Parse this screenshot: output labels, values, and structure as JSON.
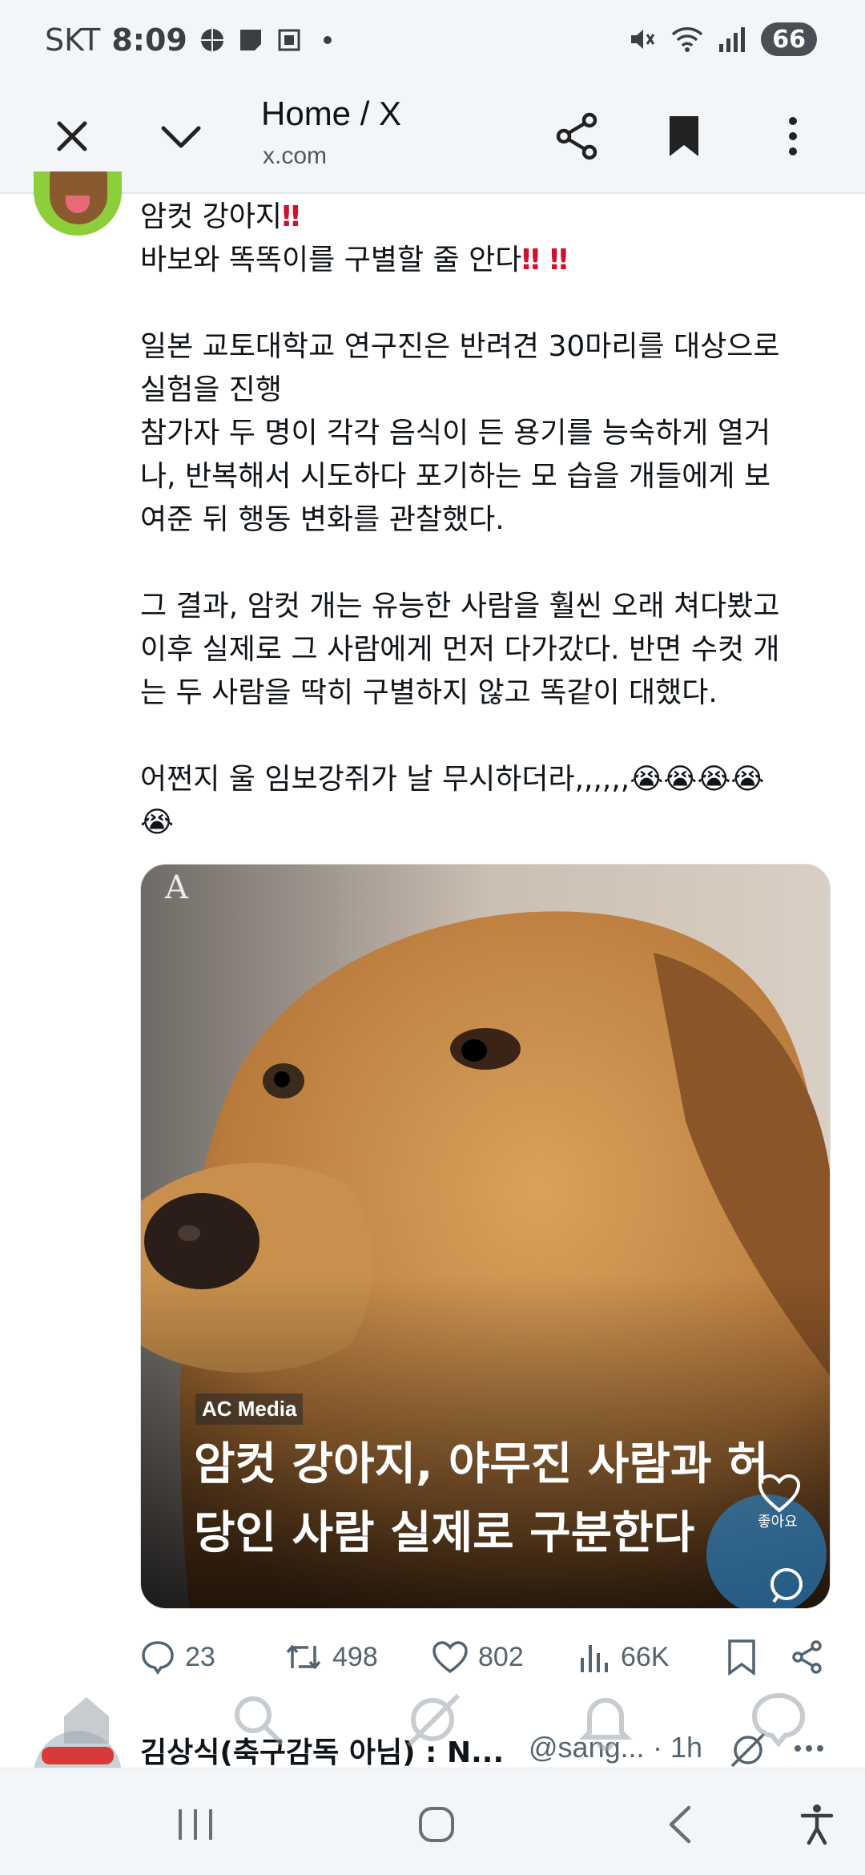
{
  "status_bar": {
    "carrier": "SKT",
    "time": "8:09",
    "battery": "66"
  },
  "toolbar": {
    "title": "Home / X",
    "url": "x.com"
  },
  "tweet": {
    "line1": "암컷 강아지",
    "line2": "바보와 똑똑이를 구별할 줄 안다",
    "para2": "일본 교토대학교 연구진은 반려견 30마리를 대상으로\n실험을 진행\n참가자 두 명이 각각 음식이 든 용기를 능숙하게 열거\n나, 반복해서 시도하다 포기하는 모 습을 개들에게 보\n여준 뒤 행동 변화를 관찰했다.",
    "para3": "그 결과, 암컷 개는 유능한 사람을 훨씬 오래 쳐다봤고\n이후 실제로 그 사람에게 먼저 다가갔다. 반면 수컷 개\n는 두 사람을 딱히 구별하지 않고 똑같이 대했다.",
    "para4": "어쩐지 울 임보강쥐가 날 무시하더라,,,,,,",
    "media": {
      "source_label": "AC Media",
      "headline": "암컷 강아지, 야무진 사람과 허당인 사람 실제로 구분한다",
      "like_label": "좋아요"
    },
    "stats": {
      "replies": "23",
      "retweets": "498",
      "likes": "802",
      "views": "66K"
    }
  },
  "next_tweet": {
    "name": "김상식(축구감독 아님) : N...",
    "handle": "@sang...",
    "time": "· 1h"
  }
}
